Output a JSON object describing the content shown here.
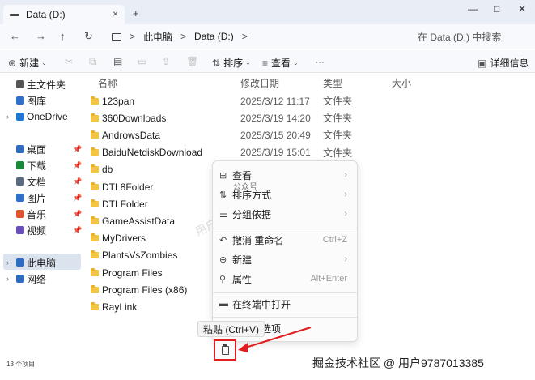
{
  "window": {
    "tab_title": "Data (D:)",
    "tab_close": "×",
    "new_tab": "+",
    "minimize": "—",
    "maximize": "□",
    "close": "✕"
  },
  "nav": {
    "back": "←",
    "forward": "→",
    "up": "↑",
    "refresh": "↻",
    "breadcrumb": [
      "此电脑",
      "Data (D:)"
    ],
    "sep": ">",
    "search_placeholder": "在 Data (D:) 中搜索"
  },
  "commands": {
    "new": "新建",
    "sort": "排序",
    "view": "查看",
    "more": "···",
    "details": "详细信息"
  },
  "sidebar": {
    "items": [
      {
        "label": "主文件夹",
        "icon": "home-icon",
        "color": "#555555"
      },
      {
        "label": "图库",
        "icon": "gallery-icon",
        "color": "#2f6fc9"
      },
      {
        "label": "OneDrive",
        "icon": "cloud-icon",
        "color": "#1e78d6"
      },
      {
        "label": "桌面",
        "icon": "desktop-icon",
        "color": "#2d6cc0"
      },
      {
        "label": "下载",
        "icon": "download-icon",
        "color": "#1a8a3a"
      },
      {
        "label": "文档",
        "icon": "documents-icon",
        "color": "#5a6a80"
      },
      {
        "label": "图片",
        "icon": "pictures-icon",
        "color": "#2f6fc9"
      },
      {
        "label": "音乐",
        "icon": "music-icon",
        "color": "#e0562b"
      },
      {
        "label": "视频",
        "icon": "video-icon",
        "color": "#6a4fb8"
      },
      {
        "label": "此电脑",
        "icon": "this-pc-icon",
        "color": "#2d6cc0"
      },
      {
        "label": "网络",
        "icon": "network-icon",
        "color": "#2d6cc0"
      }
    ]
  },
  "columns": {
    "name": "名称",
    "date": "修改日期",
    "type": "类型",
    "size": "大小"
  },
  "files": [
    {
      "name": "123pan",
      "date": "2025/3/12 11:17",
      "type": "文件夹"
    },
    {
      "name": "360Downloads",
      "date": "2025/3/19 14:20",
      "type": "文件夹"
    },
    {
      "name": "AndrowsData",
      "date": "2025/3/15 20:49",
      "type": "文件夹"
    },
    {
      "name": "BaiduNetdiskDownload",
      "date": "2025/3/19 15:01",
      "type": "文件夹"
    },
    {
      "name": "db",
      "date": "",
      "type": ""
    },
    {
      "name": "DTL8Folder",
      "date": "",
      "type": ""
    },
    {
      "name": "DTLFolder",
      "date": "",
      "type": ""
    },
    {
      "name": "GameAssistData",
      "date": "",
      "type": ""
    },
    {
      "name": "MyDrivers",
      "date": "",
      "type": ""
    },
    {
      "name": "PlantsVsZombies",
      "date": "",
      "type": ""
    },
    {
      "name": "Program Files",
      "date": "",
      "type": ""
    },
    {
      "name": "Program Files (x86)",
      "date": "",
      "type": ""
    },
    {
      "name": "RayLink",
      "date": "",
      "type": ""
    }
  ],
  "status": "13 个项目",
  "context_menu": {
    "view": "查看",
    "sort": "排序方式",
    "group": "分组依据",
    "undo": "撤消 重命名",
    "undo_shortcut": "Ctrl+Z",
    "new": "新建",
    "properties": "属性",
    "properties_shortcut": "Alt+Enter",
    "terminal": "在终端中打开",
    "more": "多选项",
    "submenu_arrow": "›"
  },
  "paste_tooltip": "粘贴 (Ctrl+V)",
  "watermark": "用户9787013385",
  "gzh": "公众号",
  "footer_mark": "掘金技术社区 @ 用户9787013385"
}
